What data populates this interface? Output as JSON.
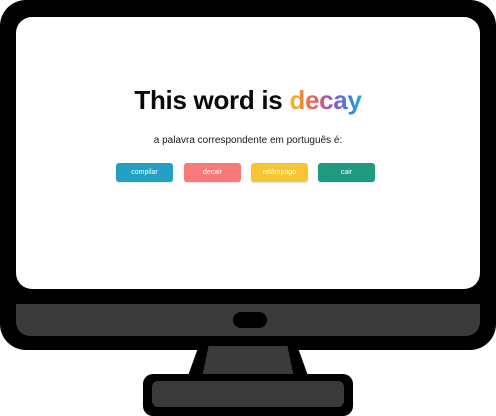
{
  "headline": {
    "prefix": "This word is ",
    "word": "decay"
  },
  "question": "a palavra correspondente em português é:",
  "options": [
    {
      "label": "compilar",
      "color": "#23a0c4"
    },
    {
      "label": "decair",
      "color": "#f77a78"
    },
    {
      "label": "relâmpago",
      "color": "#f7c531"
    },
    {
      "label": "cair",
      "color": "#1f9a80"
    }
  ],
  "colors": {
    "frame": "#000000",
    "chin": "#3a3a3a",
    "screen": "#ffffff",
    "gradient": [
      "#f2c233",
      "#f07f3a",
      "#d9557a",
      "#8a5ad0",
      "#3d7de0",
      "#2fa8d8"
    ]
  },
  "icons": {
    "power": "power-button-icon"
  }
}
